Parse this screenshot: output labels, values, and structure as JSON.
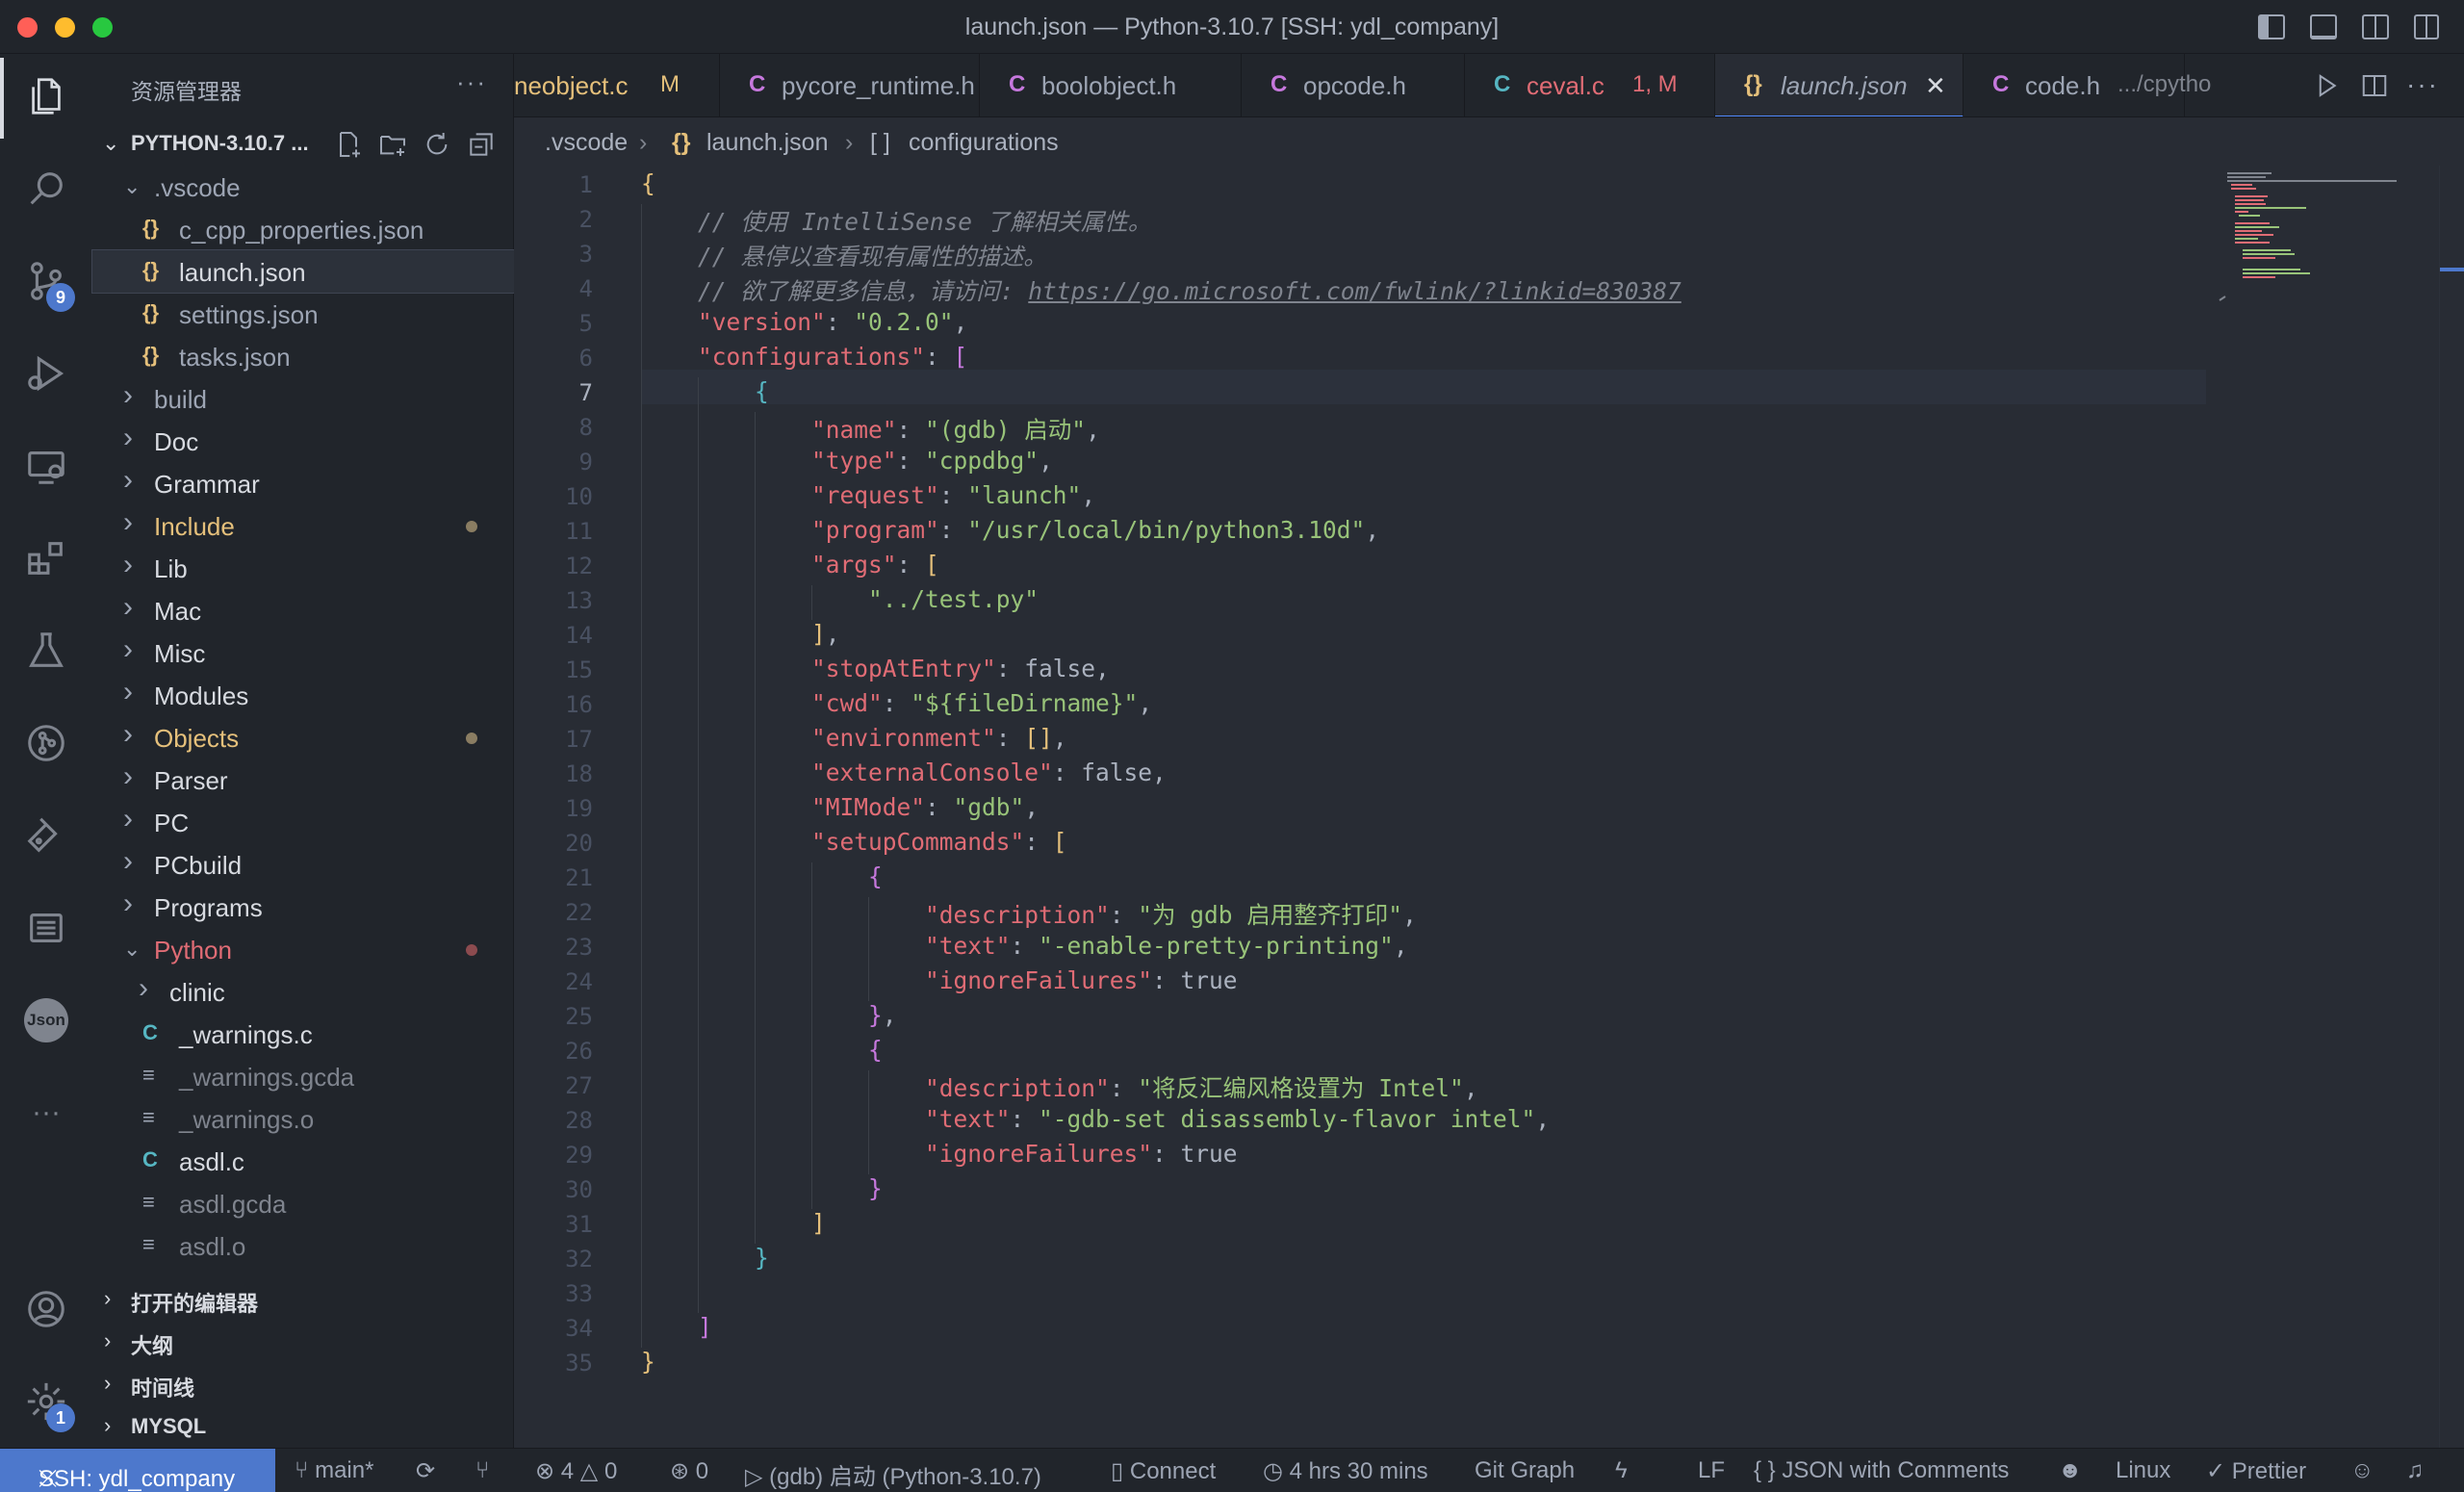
{
  "window": {
    "title": "launch.json — Python-3.10.7 [SSH: ydl_company]"
  },
  "activity": {
    "scm_badge": "9",
    "settings_badge": "1",
    "json_label": "Json"
  },
  "sidebar": {
    "header": "资源管理器",
    "more": "···",
    "root_label": "PYTHON-3.10.7 ...",
    "tree": [
      {
        "label": ".vscode",
        "kind": "folder-open",
        "depth": 0,
        "color": "#9da5b4"
      },
      {
        "label": "c_cpp_properties.json",
        "kind": "json",
        "depth": 1,
        "color": "#9da5b4"
      },
      {
        "label": "launch.json",
        "kind": "json",
        "depth": 1,
        "color": "#d7dae0",
        "selected": true
      },
      {
        "label": "settings.json",
        "kind": "json",
        "depth": 1,
        "color": "#9da5b4"
      },
      {
        "label": "tasks.json",
        "kind": "json",
        "depth": 1,
        "color": "#9da5b4"
      },
      {
        "label": "build",
        "kind": "folder",
        "depth": 0,
        "color": "#9da5b4"
      },
      {
        "label": "Doc",
        "kind": "folder",
        "depth": 0,
        "color": "#d7dae0"
      },
      {
        "label": "Grammar",
        "kind": "folder",
        "depth": 0,
        "color": "#d7dae0"
      },
      {
        "label": "Include",
        "kind": "folder",
        "depth": 0,
        "color": "#e5c07b",
        "dot": "#8a7d62"
      },
      {
        "label": "Lib",
        "kind": "folder",
        "depth": 0,
        "color": "#d7dae0"
      },
      {
        "label": "Mac",
        "kind": "folder",
        "depth": 0,
        "color": "#d7dae0"
      },
      {
        "label": "Misc",
        "kind": "folder",
        "depth": 0,
        "color": "#d7dae0"
      },
      {
        "label": "Modules",
        "kind": "folder",
        "depth": 0,
        "color": "#d7dae0"
      },
      {
        "label": "Objects",
        "kind": "folder",
        "depth": 0,
        "color": "#e5c07b",
        "dot": "#8a7d62"
      },
      {
        "label": "Parser",
        "kind": "folder",
        "depth": 0,
        "color": "#d7dae0"
      },
      {
        "label": "PC",
        "kind": "folder",
        "depth": 0,
        "color": "#d7dae0"
      },
      {
        "label": "PCbuild",
        "kind": "folder",
        "depth": 0,
        "color": "#d7dae0"
      },
      {
        "label": "Programs",
        "kind": "folder",
        "depth": 0,
        "color": "#d7dae0"
      },
      {
        "label": "Python",
        "kind": "folder-open",
        "depth": 0,
        "color": "#e06c75",
        "dot": "#8c4b4f"
      },
      {
        "label": "clinic",
        "kind": "folder",
        "depth": 1,
        "color": "#d7dae0"
      },
      {
        "label": "_warnings.c",
        "kind": "c",
        "depth": 1,
        "color": "#d7dae0"
      },
      {
        "label": "_warnings.gcda",
        "kind": "text",
        "depth": 1,
        "color": "#7f848e"
      },
      {
        "label": "_warnings.o",
        "kind": "text",
        "depth": 1,
        "color": "#7f848e"
      },
      {
        "label": "asdl.c",
        "kind": "c",
        "depth": 1,
        "color": "#d7dae0"
      },
      {
        "label": "asdl.gcda",
        "kind": "text",
        "depth": 1,
        "color": "#7f848e"
      },
      {
        "label": "asdl.o",
        "kind": "text",
        "depth": 1,
        "color": "#7f848e"
      }
    ],
    "sections": [
      "打开的编辑器",
      "大纲",
      "时间线",
      "MYSQL"
    ]
  },
  "tabs": [
    {
      "icon": "",
      "name": "neobject.c",
      "desc": "M",
      "name_color": "#e5c07b",
      "desc_color": "#e5c07b",
      "icon_color": "#c678dd"
    },
    {
      "icon": "C",
      "name": "pycore_runtime.h",
      "desc": "",
      "name_color": "#9da5b4",
      "desc_color": "#9da5b4",
      "icon_color": "#c678dd"
    },
    {
      "icon": "C",
      "name": "boolobject.h",
      "desc": "",
      "name_color": "#9da5b4",
      "desc_color": "#9da5b4",
      "icon_color": "#c678dd"
    },
    {
      "icon": "C",
      "name": "opcode.h",
      "desc": "",
      "name_color": "#9da5b4",
      "desc_color": "#9da5b4",
      "icon_color": "#c678dd"
    },
    {
      "icon": "C",
      "name": "ceval.c",
      "desc": "1, M",
      "name_color": "#e06c75",
      "desc_color": "#e06c75",
      "icon_color": "#56b6c2"
    },
    {
      "icon": "{}",
      "name": "launch.json",
      "desc": "",
      "name_color": "#9da5b4",
      "desc_color": "#9da5b4",
      "icon_color": "#e5c07b",
      "active": true
    },
    {
      "icon": "C",
      "name": "code.h",
      "desc": ".../cpytho",
      "name_color": "#9da5b4",
      "desc_color": "#7f848e",
      "icon_color": "#c678dd"
    }
  ],
  "breadcrumb": {
    "folder": ".vscode",
    "file_icon": "{}",
    "file": "launch.json",
    "node_icon": "[ ]",
    "node": "configurations"
  },
  "editor": {
    "current_line": 7,
    "lines": [
      "{",
      "    // 使用 IntelliSense 了解相关属性。",
      "    // 悬停以查看现有属性的描述。",
      "    // 欲了解更多信息，请访问: https://go.microsoft.com/fwlink/?linkid=830387",
      "    \"version\": \"0.2.0\",",
      "    \"configurations\": [",
      "        {",
      "            \"name\": \"(gdb) 启动\",",
      "            \"type\": \"cppdbg\",",
      "            \"request\": \"launch\",",
      "            \"program\": \"/usr/local/bin/python3.10d\",",
      "            \"args\": [",
      "                \"../test.py\"",
      "            ],",
      "            \"stopAtEntry\": false,",
      "            \"cwd\": \"${fileDirname}\",",
      "            \"environment\": [],",
      "            \"externalConsole\": false,",
      "            \"MIMode\": \"gdb\",",
      "            \"setupCommands\": [",
      "                {",
      "                    \"description\": \"为 gdb 启用整齐打印\",",
      "                    \"text\": \"-enable-pretty-printing\",",
      "                    \"ignoreFailures\": true",
      "                },",
      "                {",
      "                    \"description\": \"将反汇编风格设置为 Intel\",",
      "                    \"text\": \"-gdb-set disassembly-flavor intel\",",
      "                    \"ignoreFailures\": true",
      "                }",
      "            ]",
      "        }",
      "",
      "    ]",
      "}"
    ]
  },
  "statusbar": {
    "remote": "SSH: ydl_company",
    "branch": "main*",
    "errors": "4",
    "warnings": "0",
    "ports": "0",
    "debug": "(gdb) 启动 (Python-3.10.7)",
    "connect": "Connect",
    "time": "4 hrs 30 mins",
    "git_graph": "Git Graph",
    "eol": "LF",
    "language": "JSON with Comments",
    "os": "Linux",
    "prettier": "Prettier"
  },
  "colors": {
    "accent": "#4d78cc",
    "key": "#e06c75",
    "string": "#98c379",
    "comment": "#7f848e"
  }
}
